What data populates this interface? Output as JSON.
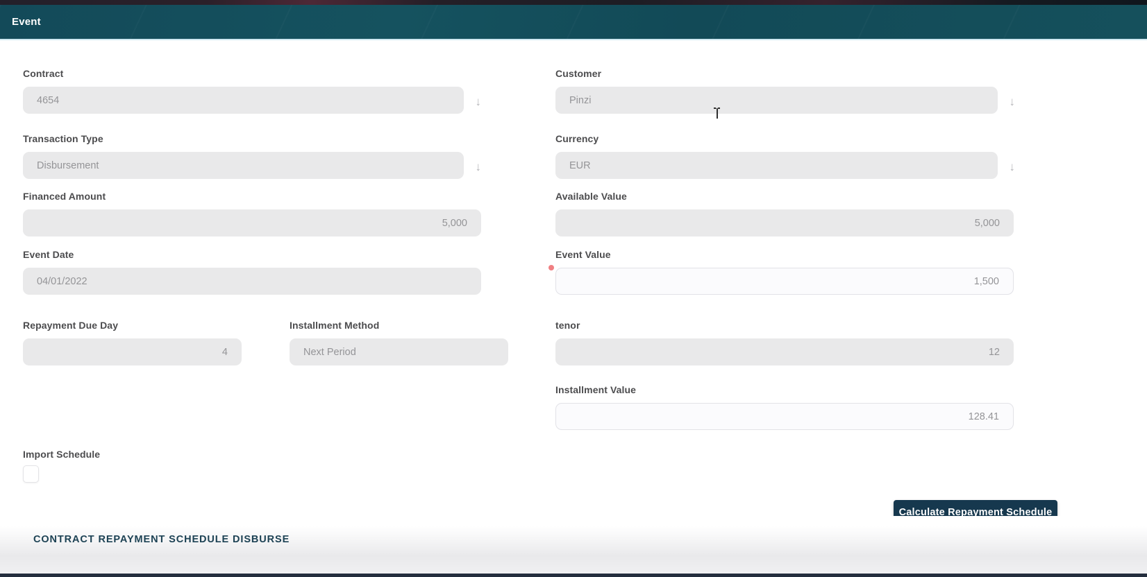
{
  "header": {
    "title": "Event"
  },
  "form": {
    "contract": {
      "label": "Contract",
      "value": "4654"
    },
    "customer": {
      "label": "Customer",
      "value": "Pinzi"
    },
    "transaction_type": {
      "label": "Transaction Type",
      "value": "Disbursement"
    },
    "currency": {
      "label": "Currency",
      "value": "EUR"
    },
    "financed_amount": {
      "label": "Financed Amount",
      "value": "5,000"
    },
    "available_value": {
      "label": "Available Value",
      "value": "5,000"
    },
    "event_date": {
      "label": "Event Date",
      "value": "04/01/2022"
    },
    "event_value": {
      "label": "Event Value",
      "value": "1,500",
      "required": true
    },
    "repayment_due_day": {
      "label": "Repayment Due Day",
      "value": "4"
    },
    "installment_method": {
      "label": "Installment Method",
      "value": "Next Period"
    },
    "tenor": {
      "label": "tenor",
      "value": "12"
    },
    "installment_value": {
      "label": "Installment Value",
      "value": "128.41"
    },
    "import_schedule": {
      "label": "Import Schedule",
      "checked": false
    }
  },
  "actions": {
    "calculate_button": "Calculate Repayment Schedule"
  },
  "bottom_section": {
    "title": "CONTRACT REPAYMENT SCHEDULE DISBURSE"
  },
  "icons": {
    "dropdown_arrow": "↓"
  },
  "colors": {
    "header_bg": "#15525f",
    "button_bg": "#16384e",
    "field_bg": "#e9e9ea",
    "editable_field_bg": "#fbfbfd",
    "required_dot": "#f07f82",
    "section_title": "#1d4254"
  }
}
